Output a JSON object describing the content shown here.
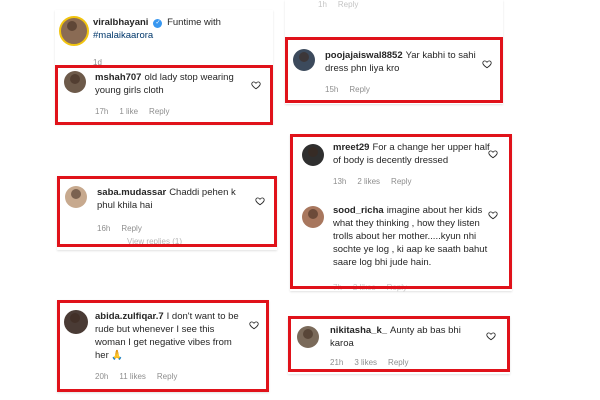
{
  "post": {
    "username": "viralbhayani",
    "caption_prefix": "Funtime with",
    "caption_mention": "#malaikaarora",
    "age": "1d"
  },
  "comments": [
    {
      "user": "mshah707",
      "text": "old lady stop wearing young girls cloth",
      "time": "17h",
      "likes": "1 like",
      "reply": "Reply"
    },
    {
      "user": "poojajaiswal8852",
      "text": "Yar kabhi to sahi dress phn liya kro",
      "time": "15h",
      "reply": "Reply"
    },
    {
      "user": "mreet29",
      "text": "For a change her upper half of body is decently dressed",
      "time": "13h",
      "likes": "2 likes",
      "reply": "Reply"
    },
    {
      "user": "sood_richa",
      "text": "imagine about her kids what they thinking , how they listen trolls about her mother.....kyun nhi sochte ye log , ki aap ke saath bahut saare log bhi jude hain.",
      "time": "7h",
      "likes": "2 likes",
      "reply": "Reply"
    },
    {
      "user": "saba.mudassar",
      "text": "Chaddi pehen k phul khila hai",
      "time": "16h",
      "reply": "Reply",
      "view_replies": "View replies (1)"
    },
    {
      "user": "abida.zulfiqar.7",
      "text": "I don't want to be rude but whenever I see this woman I get negative vibes from her 🙏",
      "time": "20h",
      "likes": "11 likes",
      "reply": "Reply"
    },
    {
      "user": "nikitasha_k_",
      "text": "Aunty ab bas bhi karoa",
      "time": "21h",
      "likes": "3 likes",
      "reply": "Reply"
    }
  ],
  "top_partial": {
    "time": "1h",
    "reply": "Reply"
  },
  "colors": {
    "highlight_box": "#e0121a",
    "meta_gray": "#8e8e8e"
  }
}
